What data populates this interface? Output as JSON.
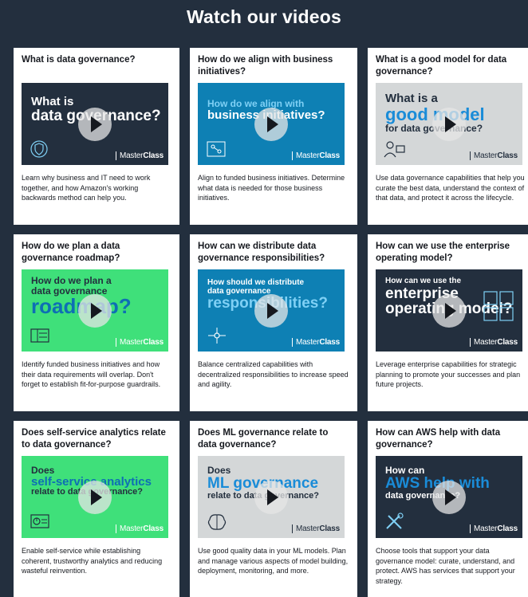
{
  "page": {
    "title": "Watch our videos"
  },
  "brand": {
    "logo_light": "Master",
    "logo_bold": "Class"
  },
  "colors": {
    "background": "#232f3e",
    "dark_thumb": "#232f3e",
    "blue_thumb": "#0e80b4",
    "light_thumb": "#d4d7d8",
    "green_thumb": "#3fe07a"
  },
  "cards": [
    {
      "title": "What is data governance?",
      "thumb_line1": "What is",
      "thumb_line2": "data governance?",
      "thumb_line3": "",
      "desc": "Learn why business and IT need to work together, and how Amazon's working backwards method can help you.",
      "icon": "shield-icon"
    },
    {
      "title": "How do we align with business initiatives?",
      "thumb_line1": "How do we align with",
      "thumb_line2": "business initiatives?",
      "thumb_line3": "",
      "desc": "Align to funded business initiatives. Determine what data is needed for those business initiatives.",
      "icon": "flowchart-icon"
    },
    {
      "title": "What is a good model for data governance?",
      "thumb_line1": "What is a",
      "thumb_line2": "good model",
      "thumb_line3": "for data governance?",
      "desc": "Use data governance capabilities that help you curate the best data, understand the context of that data, and protect it across the lifecycle.",
      "icon": "user-computer-icon"
    },
    {
      "title": "How do we plan a data governance roadmap?",
      "thumb_line1": "How do we plan a",
      "thumb_line2": "data governance",
      "thumb_line3": "roadmap?",
      "desc": "Identify funded business initiatives and how their data requirements will overlap. Don't forget to establish fit-for-purpose guardrails.",
      "icon": "roadmap-icon"
    },
    {
      "title": "How can we distribute data governance responsibilities?",
      "thumb_line1": "How should we distribute",
      "thumb_line2": "data governance",
      "thumb_line3": "responsibilities?",
      "desc": "Balance centralized capabilities with decentralized responsibilities to increase speed and agility.",
      "icon": "network-icon"
    },
    {
      "title": "How can we use the enterprise operating model?",
      "thumb_line1": "How can we use the",
      "thumb_line2": "enterprise",
      "thumb_line3": "operating model?",
      "desc": "Leverage enterprise capabilities for strategic planning to promote your successes and plan future projects.",
      "icon": "grid-chart-icon"
    },
    {
      "title": "Does self-service analytics relate to data governance?",
      "thumb_line1": "Does",
      "thumb_line2": "self-service analytics",
      "thumb_line3": "relate to data governance?",
      "desc": "Enable self-service while establishing coherent, trustworthy analytics and reducing wasteful reinvention.",
      "icon": "analytics-icon"
    },
    {
      "title": "Does ML governance relate to data governance?",
      "thumb_line1": "Does",
      "thumb_line2": "ML governance",
      "thumb_line3": "relate to data governance?",
      "desc": "Use good quality data in your ML models. Plan and manage various aspects of model building, deployment, monitoring, and more.",
      "icon": "brain-icon"
    },
    {
      "title": "How can AWS help with data governance?",
      "thumb_line1": "How can",
      "thumb_line2": "AWS help with",
      "thumb_line3": "data governance?",
      "desc": "Choose tools that support your data governance model: curate, understand, and protect. AWS has services that support your strategy.",
      "icon": "tools-icon"
    }
  ]
}
